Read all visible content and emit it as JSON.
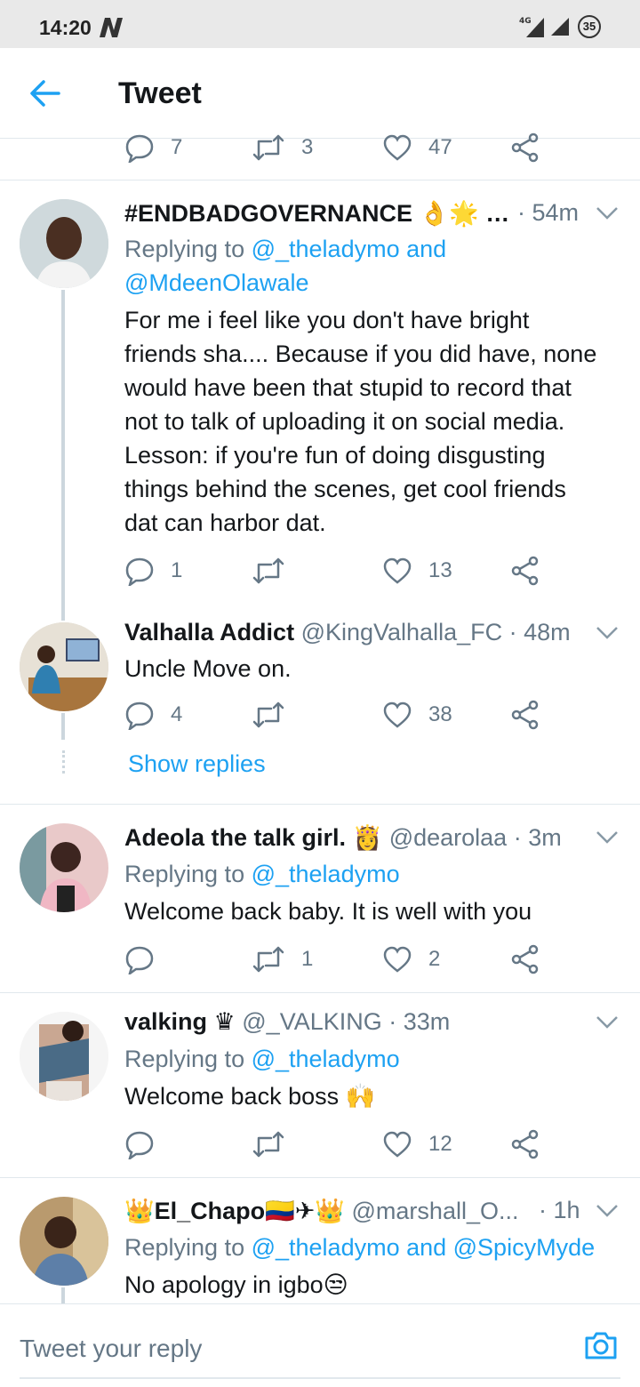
{
  "status_bar": {
    "time": "14:20",
    "network": "4G",
    "battery": "35"
  },
  "header": {
    "title": "Tweet"
  },
  "top_actions": {
    "replies": "7",
    "retweets": "3",
    "likes": "47"
  },
  "tweets": [
    {
      "name": "#ENDBADGOVERNANCE 👌🌟 …",
      "handle": "",
      "time": "· 54m",
      "replying_prefix": "Replying to ",
      "replying_users": "@_theladymo and",
      "replying_users_2": "@MdeenOlawale",
      "text_lines": [
        "For me i feel like you don't have bright",
        "friends sha.... Because if you did have, none",
        "would have been that stupid to record that",
        "not to talk of uploading it on social media.",
        "Lesson: if you're fun of doing disgusting",
        "things behind the scenes, get cool friends",
        "dat can harbor dat."
      ],
      "replies": "1",
      "retweets": "",
      "likes": "13"
    },
    {
      "name": "Valhalla Addict",
      "handle": "@KingValhalla_FC",
      "time": "· 48m",
      "text": "Uncle Move on.",
      "replies": "4",
      "retweets": "",
      "likes": "38"
    },
    {
      "name": "Adeola the talk girl. 👸",
      "handle": "@dearolaa",
      "time": "· 3m",
      "replying_prefix": "Replying to ",
      "replying_users": "@_theladymo",
      "text": "Welcome back baby. It is well with you",
      "replies": "",
      "retweets": "1",
      "likes": "2"
    },
    {
      "name": "valking ♛",
      "handle": "@_VALKING",
      "time": "· 33m",
      "replying_prefix": "Replying to ",
      "replying_users": "@_theladymo",
      "text": "Welcome back boss 🙌",
      "replies": "",
      "retweets": "",
      "likes": "12"
    },
    {
      "name": "👑El_Chapo🇨🇴✈👑",
      "handle": "@marshall_O...",
      "time": "· 1h",
      "replying_prefix": "Replying to ",
      "replying_users": "@_theladymo and @SpicyMyde",
      "text": "No apology in igbo😒"
    }
  ],
  "show_replies": "Show replies",
  "composer": {
    "placeholder": "Tweet your reply"
  },
  "colors": {
    "accent": "#1da1f2",
    "muted": "#657786",
    "text": "#14171a",
    "border": "#e1e8ed"
  }
}
